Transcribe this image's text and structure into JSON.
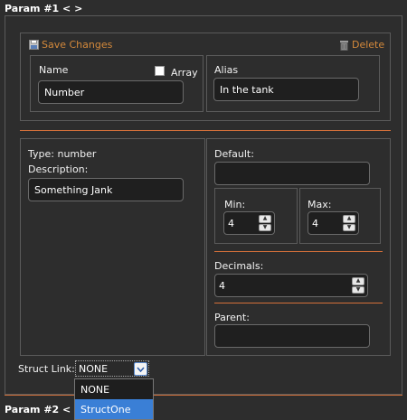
{
  "param1": {
    "header": "Param #1 < >"
  },
  "param2": {
    "header": "Param #2 < >"
  },
  "actions": {
    "save_label": "Save Changes",
    "delete_label": "Delete",
    "save_icon": "floppy-disk-icon",
    "delete_icon": "trash-icon"
  },
  "name": {
    "label": "Name",
    "value": "Number"
  },
  "array": {
    "label": "Array",
    "checked": false
  },
  "alias": {
    "label": "Alias",
    "value": "In the tank"
  },
  "info": {
    "type_text": "Type: number",
    "description_label": "Description:",
    "description_value": "Something Jank"
  },
  "default": {
    "label": "Default:",
    "value": ""
  },
  "min": {
    "label": "Min:",
    "value": "4"
  },
  "max": {
    "label": "Max:",
    "value": "4"
  },
  "decimals": {
    "label": "Decimals:",
    "value": "4"
  },
  "parent": {
    "label": "Parent:",
    "value": ""
  },
  "struct_link": {
    "label": "Struct Link:",
    "selected": "NONE",
    "options": [
      "NONE",
      "StructOne"
    ],
    "highlighted_option": "StructOne"
  },
  "colors": {
    "accent": "#d4703a",
    "link": "#d4893b",
    "highlight": "#3a7fd6",
    "background": "#2d2d2d"
  }
}
